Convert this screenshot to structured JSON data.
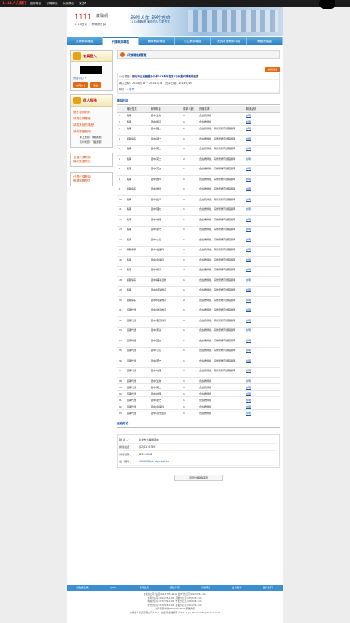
{
  "topbar": {
    "logo": "1111人力銀行",
    "links": [
      "國際專區",
      "公職專區",
      "採認專區",
      "更多▾"
    ]
  },
  "brand": {
    "num": "1111",
    "num2": "教職網",
    "sub": "1111首頁 ｜ 教職網首頁",
    "slogan1": "新的人生  新的方向",
    "slogan2": "1111教職網 讓你的人生更豐富"
  },
  "nav": [
    "大專教師專區",
    "代課教師專區",
    "補教教師專區",
    "公立教師專區",
    "我的才藝教師共組",
    "教甄經驗區"
  ],
  "side": {
    "login_title": "會員登入",
    "login_link": "會員中心 >",
    "buttons": [
      "會員中心",
      "登出"
    ],
    "person_title": "個人服務",
    "menu": [
      "徵才瀏覽資料",
      "填寫自傳履歷",
      "填寫其他的學歷",
      "我的履歷管理"
    ],
    "submenu": [
      "‧ 線上履歷 ‧ 求職履歷",
      "‧ 列印履歷 ‧ 下載履歷"
    ],
    "promo1": [
      "全國代課教師",
      "最新甄選資訊"
    ],
    "promo2": [
      "代理代課教師",
      "甄選相關問答"
    ]
  },
  "main": {
    "title": "代課職缺瀏覽",
    "back_btn": "關閉視窗",
    "info_title_label": "公告標題：",
    "info_title": "新北市立福營國民中學103學年度第2次代理代課教師甄選",
    "post_label": "報名日期：",
    "post_dates": "2014/7/15 ~ 2014/7/16",
    "rt_label": "簡章日期：",
    "rt_value": "2014/7/15",
    "att_label": "附件：",
    "att_value": "▸ 簡章",
    "list_title": "職缺列表",
    "cols": [
      "",
      "職缺性質",
      "教學科目",
      "需求人數",
      "資格需求",
      "職缺說明"
    ]
  },
  "rows": [
    [
      "1",
      "長期",
      "國中-生物",
      "1",
      "合格教師證",
      "說明"
    ],
    [
      "2",
      "長期",
      "國中-體育",
      "1",
      "合格教師證",
      "說明"
    ],
    [
      "3",
      "長期",
      "國中-國文",
      "2",
      "合格教師證、需修習教育課程證明",
      "說明"
    ],
    [
      "4",
      "留職停薪",
      "國中-國文",
      "1",
      "合格教師證、需修習教育課程證明",
      "說明"
    ],
    [
      "5",
      "長期",
      "國中-英文",
      "1",
      "合格教師證、需修習教育課程證明",
      "說明"
    ],
    [
      "6",
      "長期",
      "國中-英文",
      "2",
      "合格教師證、需修習教育課程證明",
      "說明"
    ],
    [
      "7",
      "長期",
      "國中-英文",
      "1",
      "合格教師證、需修習教育課程證明",
      "說明"
    ],
    [
      "8",
      "長期",
      "國中-數學",
      "1",
      "合格教師證、需修習教育課程證明",
      "說明"
    ],
    [
      "9",
      "留職停薪",
      "國中-數學",
      "1",
      "合格教師證、需修習教育課程證明",
      "說明"
    ],
    [
      "10",
      "長期",
      "國中-數學",
      "1",
      "合格教師證、需修習教育課程證明",
      "說明"
    ],
    [
      "11",
      "長期",
      "國中-理化",
      "1",
      "合格教師證、需修習教育課程證明",
      "說明"
    ],
    [
      "12",
      "長期",
      "國中-地理",
      "1",
      "合格教師證、需修習教育課程證明",
      "說明"
    ],
    [
      "13",
      "長期",
      "國中-歷史",
      "1",
      "合格教師證、需修習教育課程證明",
      "說明"
    ],
    [
      "14",
      "長期",
      "國中-公民",
      "1",
      "合格教師證、需修習教育課程證明",
      "說明"
    ],
    [
      "15",
      "留職停薪",
      "國中-電腦科",
      "1",
      "合格教師證、需修習教育課程證明",
      "說明"
    ],
    [
      "16",
      "長期",
      "國中-電腦科",
      "1",
      "合格教師證、需修習教育課程證明",
      "說明"
    ],
    [
      "17",
      "長期",
      "國中-體育",
      "2",
      "合格教師證、需修習教育課程證明",
      "說明"
    ],
    [
      "18",
      "留職停薪",
      "國中-輔導活動",
      "1",
      "合格教師證、需修習教育課程證明",
      "說明"
    ],
    [
      "19",
      "長期",
      "國中-特殊教育",
      "1",
      "合格教師證、需修習教育課程證明",
      "說明"
    ],
    [
      "20",
      "留職停薪",
      "國中-特殊教育",
      "2",
      "合格教師證、需修習教育課程證明",
      "說明"
    ],
    [
      "21",
      "短期代課",
      "國中-健康教育",
      "1",
      "合格教師證、需修習教育課程證明",
      "說明"
    ],
    [
      "22",
      "短期代課",
      "國中-童軍教育",
      "1",
      "合格教師證、需修習教育課程證明",
      "說明"
    ],
    [
      "23",
      "短期代課",
      "國中-家政",
      "1",
      "合格教師證、需修習教育課程證明",
      "說明"
    ],
    [
      "24",
      "短期代課",
      "國中-國文",
      "1",
      "合格教師證、需修習教育課程證明",
      "說明"
    ],
    [
      "25",
      "短期代課",
      "國中-公民",
      "1",
      "合格教師證、需修習教育課程證明",
      "說明"
    ],
    [
      "26",
      "短期代課",
      "國中-歷史",
      "1",
      "合格教師證、需修習教育課程證明",
      "說明"
    ],
    [
      "27",
      "短期代課",
      "國中-地理",
      "1",
      "合格教師證、需修習教育課程證明",
      "說明"
    ],
    [
      "28",
      "短期代課",
      "國中-生物",
      "1",
      "合格教師證",
      "說明"
    ],
    [
      "29",
      "短期代課",
      "國中-英文",
      "1",
      "合格教師證",
      "說明"
    ],
    [
      "30",
      "短期代課",
      "國中-地理",
      "1",
      "合格教師證",
      "說明"
    ],
    [
      "31",
      "短期代課",
      "國中-歷史",
      "1",
      "合格教師證",
      "說明"
    ],
    [
      "32",
      "短期代課",
      "國中-電腦科",
      "1",
      "合格教師證",
      "說明"
    ],
    [
      "33",
      "短期代課",
      "國中-音樂藝術",
      "1",
      "合格教師證",
      "說明"
    ]
  ],
  "contact": {
    "title": "連絡方式",
    "rows": [
      {
        "label": "聯 絡 人：",
        "value": "新北市立福營國中"
      },
      {
        "label": "聯絡電話：",
        "value": "(02)22747491"
      },
      {
        "label": "傳真號碼：",
        "value": "2222-0342"
      },
      {
        "label": "電子郵件：",
        "value": "A8036@fyjh.ntpc.edu.tw"
      }
    ],
    "back": "返回代課職缺首頁"
  },
  "footer": {
    "nav": [
      "隱私權政策",
      "Q&A",
      "意見反應",
      "廣告刊登",
      "系統問題",
      "合作夥伴",
      "關於我們"
    ],
    "lines": [
      "台北總公司 電話 (02)2705-1111  台中分公司 (04)2326-1111",
      "台南分公司 (06)275-1111  高雄分公司 (07)555-1111",
      "桃園分公司 (03)339-1111  竹北分公司 (03)658-1111",
      "新竹分公司 (03)523-1111  嘉義分公司 (05)222-1111",
      "客戶服務專線 0800-00-1111 網路客服"
    ],
    "copyright": "全球華人資訊有限公司(1111人力銀行)版權所有 © 1111 Job Bank All Rights Reserved"
  }
}
